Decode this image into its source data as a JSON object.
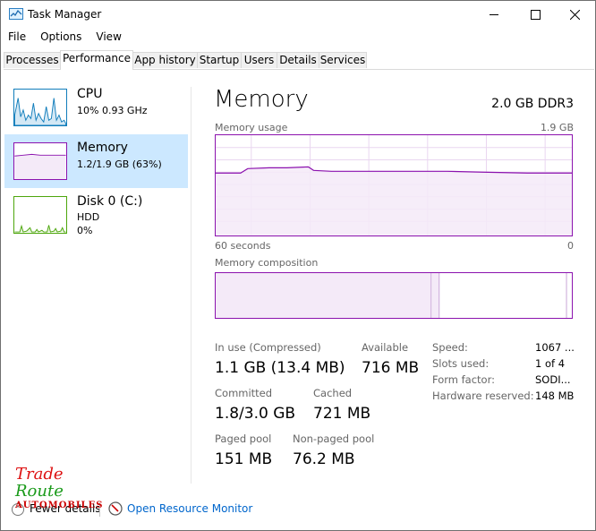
{
  "window": {
    "title": "Task Manager"
  },
  "menu": [
    "File",
    "Options",
    "View"
  ],
  "tabs": [
    "Processes",
    "Performance",
    "App history",
    "Startup",
    "Users",
    "Details",
    "Services"
  ],
  "active_tab": "Performance",
  "resources": [
    {
      "name": "CPU",
      "sub1": "10%  0.93 GHz",
      "sub2": "",
      "color": "#117dbb"
    },
    {
      "name": "Memory",
      "sub1": "1.2/1.9 GB (63%)",
      "sub2": "",
      "color": "#8b12ae"
    },
    {
      "name": "Disk 0 (C:)",
      "sub1": "HDD",
      "sub2": "0%",
      "color": "#4da60c"
    }
  ],
  "memory": {
    "heading": "Memory",
    "spec": "2.0 GB DDR3",
    "usage_label": "Memory usage",
    "usage_max": "1.9 GB",
    "time_left": "60 seconds",
    "time_right": "0",
    "composition_label": "Memory composition",
    "stats": {
      "in_use_label": "In use (Compressed)",
      "in_use_value": "1.1 GB (13.4 MB)",
      "available_label": "Available",
      "available_value": "716 MB",
      "committed_label": "Committed",
      "committed_value": "1.8/3.0 GB",
      "cached_label": "Cached",
      "cached_value": "721 MB",
      "paged_label": "Paged pool",
      "paged_value": "151 MB",
      "nonpaged_label": "Non-paged pool",
      "nonpaged_value": "76.2 MB"
    },
    "details": [
      {
        "label": "Speed:",
        "value": "1067 ..."
      },
      {
        "label": "Slots used:",
        "value": "1 of 4"
      },
      {
        "label": "Form factor:",
        "value": "SODI..."
      },
      {
        "label": "Hardware reserved:",
        "value": "148 MB"
      }
    ]
  },
  "footer": {
    "fewer_details": "Fewer details",
    "open_resource_monitor": "Open Resource Monitor"
  },
  "logo": {
    "line1": "Trade",
    "line2": "Route",
    "line3": "AUTOMOBILES"
  }
}
